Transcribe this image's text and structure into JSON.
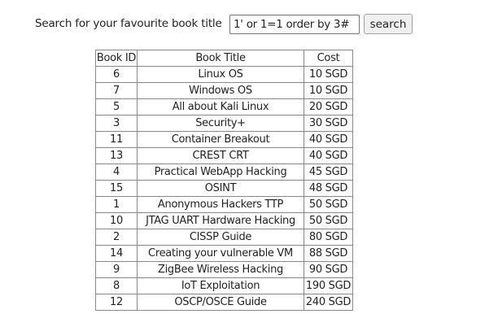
{
  "search": {
    "label": "Search for your favourite book title",
    "value": "1' or 1=1 order by 3#",
    "button": "search"
  },
  "table": {
    "headers": [
      "Book ID",
      "Book Title",
      "Cost"
    ],
    "rows": [
      [
        "6",
        "Linux OS",
        "10 SGD"
      ],
      [
        "7",
        "Windows OS",
        "10 SGD"
      ],
      [
        "5",
        "All about Kali Linux",
        "20 SGD"
      ],
      [
        "3",
        "Security+",
        "30 SGD"
      ],
      [
        "11",
        "Container Breakout",
        "40 SGD"
      ],
      [
        "13",
        "CREST CRT",
        "40 SGD"
      ],
      [
        "4",
        "Practical WebApp Hacking",
        "45 SGD"
      ],
      [
        "15",
        "OSINT",
        "48 SGD"
      ],
      [
        "1",
        "Anonymous Hackers TTP",
        "50 SGD"
      ],
      [
        "10",
        "JTAG UART Hardware Hacking",
        "50 SGD"
      ],
      [
        "2",
        "CISSP Guide",
        "80 SGD"
      ],
      [
        "14",
        "Creating your vulnerable VM",
        "88 SGD"
      ],
      [
        "9",
        "ZigBee Wireless Hacking",
        "90 SGD"
      ],
      [
        "8",
        "IoT Exploitation",
        "190 SGD"
      ],
      [
        "12",
        "OSCP/OSCE Guide",
        "240 SGD"
      ]
    ]
  }
}
